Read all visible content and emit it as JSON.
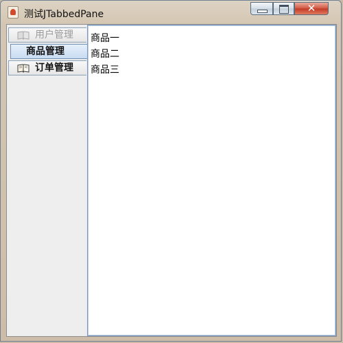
{
  "window": {
    "title": "测试JTabbedPane",
    "app_icon": "java-coffee-icon",
    "controls": {
      "minimize_icon": "minimize-icon",
      "maximize_icon": "maximize-icon",
      "close_icon": "close-icon",
      "close_glyph": "✕"
    }
  },
  "tabs": [
    {
      "label": "用户管理",
      "icon": "book-icon",
      "state": "disabled"
    },
    {
      "label": "商品管理",
      "icon": "",
      "state": "selected"
    },
    {
      "label": "订单管理",
      "icon": "book-icon",
      "state": "normal"
    }
  ],
  "content": {
    "items": [
      "商品一",
      "商品二",
      "商品三"
    ]
  },
  "colors": {
    "selected_tab": "#c9dcf2",
    "tab_border": "#8aa0b8",
    "close_button": "#c23a24",
    "disabled_text": "#9a9a9a"
  }
}
